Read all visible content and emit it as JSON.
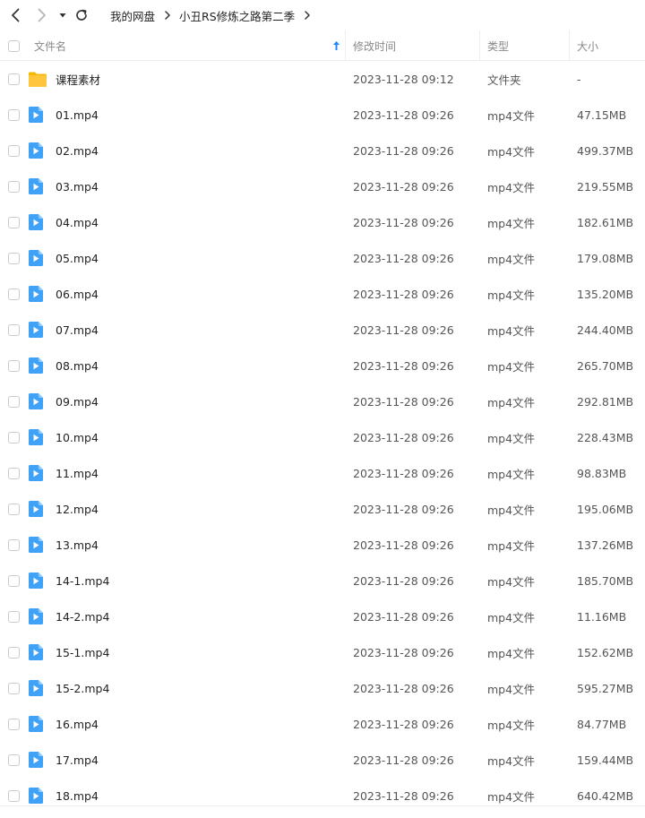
{
  "nav": {
    "back_icon": "chevron-left-icon",
    "forward_icon": "chevron-right-icon",
    "dropdown_icon": "caret-down-icon",
    "refresh_icon": "refresh-icon"
  },
  "breadcrumb": {
    "items": [
      "我的网盘",
      "小丑RS修炼之路第二季"
    ]
  },
  "columns": {
    "name": "文件名",
    "modified": "修改时间",
    "type": "类型",
    "size": "大小"
  },
  "sort": {
    "column": "name",
    "icon": "sort-arrow-up-icon",
    "color": "#1e88ff"
  },
  "colors": {
    "folder": "#ffc53d",
    "video": "#3fa2f7",
    "accent": "#1e88ff"
  },
  "files": [
    {
      "name": "课程素材",
      "modified": "2023-11-28 09:12",
      "type": "文件夹",
      "size": "-",
      "icon": "folder-icon"
    },
    {
      "name": "01.mp4",
      "modified": "2023-11-28 09:26",
      "type": "mp4文件",
      "size": "47.15MB",
      "icon": "video-file-icon"
    },
    {
      "name": "02.mp4",
      "modified": "2023-11-28 09:26",
      "type": "mp4文件",
      "size": "499.37MB",
      "icon": "video-file-icon"
    },
    {
      "name": "03.mp4",
      "modified": "2023-11-28 09:26",
      "type": "mp4文件",
      "size": "219.55MB",
      "icon": "video-file-icon"
    },
    {
      "name": "04.mp4",
      "modified": "2023-11-28 09:26",
      "type": "mp4文件",
      "size": "182.61MB",
      "icon": "video-file-icon"
    },
    {
      "name": "05.mp4",
      "modified": "2023-11-28 09:26",
      "type": "mp4文件",
      "size": "179.08MB",
      "icon": "video-file-icon"
    },
    {
      "name": "06.mp4",
      "modified": "2023-11-28 09:26",
      "type": "mp4文件",
      "size": "135.20MB",
      "icon": "video-file-icon"
    },
    {
      "name": "07.mp4",
      "modified": "2023-11-28 09:26",
      "type": "mp4文件",
      "size": "244.40MB",
      "icon": "video-file-icon"
    },
    {
      "name": "08.mp4",
      "modified": "2023-11-28 09:26",
      "type": "mp4文件",
      "size": "265.70MB",
      "icon": "video-file-icon"
    },
    {
      "name": "09.mp4",
      "modified": "2023-11-28 09:26",
      "type": "mp4文件",
      "size": "292.81MB",
      "icon": "video-file-icon"
    },
    {
      "name": "10.mp4",
      "modified": "2023-11-28 09:26",
      "type": "mp4文件",
      "size": "228.43MB",
      "icon": "video-file-icon"
    },
    {
      "name": "11.mp4",
      "modified": "2023-11-28 09:26",
      "type": "mp4文件",
      "size": "98.83MB",
      "icon": "video-file-icon"
    },
    {
      "name": "12.mp4",
      "modified": "2023-11-28 09:26",
      "type": "mp4文件",
      "size": "195.06MB",
      "icon": "video-file-icon"
    },
    {
      "name": "13.mp4",
      "modified": "2023-11-28 09:26",
      "type": "mp4文件",
      "size": "137.26MB",
      "icon": "video-file-icon"
    },
    {
      "name": "14-1.mp4",
      "modified": "2023-11-28 09:26",
      "type": "mp4文件",
      "size": "185.70MB",
      "icon": "video-file-icon"
    },
    {
      "name": "14-2.mp4",
      "modified": "2023-11-28 09:26",
      "type": "mp4文件",
      "size": "11.16MB",
      "icon": "video-file-icon"
    },
    {
      "name": "15-1.mp4",
      "modified": "2023-11-28 09:26",
      "type": "mp4文件",
      "size": "152.62MB",
      "icon": "video-file-icon"
    },
    {
      "name": "15-2.mp4",
      "modified": "2023-11-28 09:26",
      "type": "mp4文件",
      "size": "595.27MB",
      "icon": "video-file-icon"
    },
    {
      "name": "16.mp4",
      "modified": "2023-11-28 09:26",
      "type": "mp4文件",
      "size": "84.77MB",
      "icon": "video-file-icon"
    },
    {
      "name": "17.mp4",
      "modified": "2023-11-28 09:26",
      "type": "mp4文件",
      "size": "159.44MB",
      "icon": "video-file-icon"
    },
    {
      "name": "18.mp4",
      "modified": "2023-11-28 09:26",
      "type": "mp4文件",
      "size": "640.42MB",
      "icon": "video-file-icon"
    }
  ]
}
